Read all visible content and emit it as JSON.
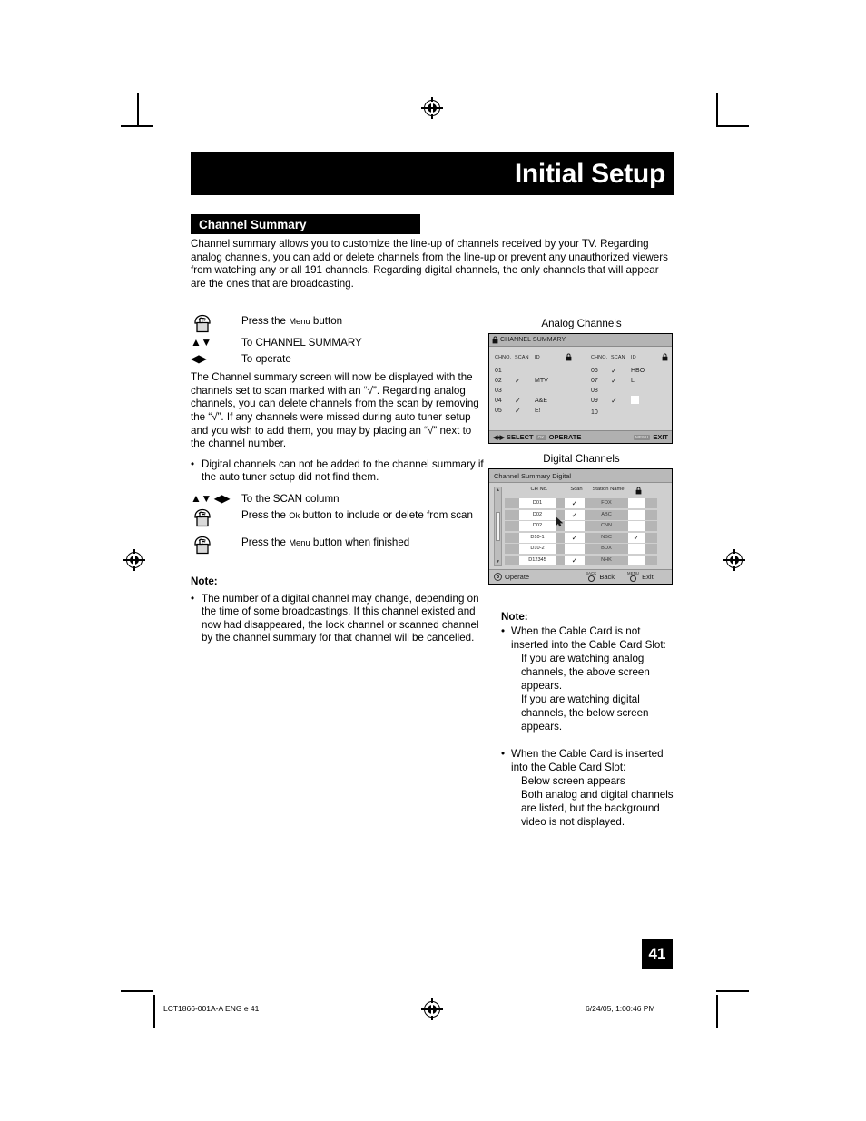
{
  "page": {
    "chapter_title": "Initial Setup",
    "section_title": "Channel Summary",
    "intro": "Channel summary allows you to customize the line-up of channels received by your TV. Regarding analog channels, you can add or delete channels from the line-up or prevent any unauthorized viewers from watching any or all 191 channels.  Regarding digital channels, the only channels that will appear are the ones that are broadcasting.",
    "page_number": "41"
  },
  "steps": [
    {
      "icon": "hand-press-icon",
      "text_pre": "Press the ",
      "smallcaps": "Menu",
      "text_post": " button"
    },
    {
      "icon": "up-down-arrows-icon",
      "glyph": "▲▼",
      "text": "To CHANNEL SUMMARY"
    },
    {
      "icon": "left-right-arrows-icon",
      "glyph": "◀▶",
      "text": "To operate"
    }
  ],
  "body": {
    "paragraph": "The Channel summary screen will now be displayed with the channels set to scan marked with an “√”. Regarding analog channels, you can delete channels from the scan by removing the “√”. If any channels were missed during auto tuner setup and you wish to add them, you may by placing an “√” next to the channel number.",
    "bullet": "Digital channels can not be added to the channel summary if the auto tuner setup did not find them."
  },
  "steps2": [
    {
      "icon": "updown-leftright-arrows-icon",
      "glyph": "▲▼ ◀▶",
      "text": "To the SCAN column"
    },
    {
      "icon": "hand-press-icon",
      "text_pre": "Press the ",
      "smallcaps": "Ok",
      "text_post": " button to include or delete from scan"
    },
    {
      "icon": "hand-press-icon",
      "text_pre": "Press the ",
      "smallcaps": "Menu",
      "text_post": " button when finished"
    }
  ],
  "left_note": {
    "heading": "Note:",
    "bullet": "The number of a digital channel may change, depending on the time of some broadcastings.  If this channel existed and now had disappeared, the lock channel or scanned channel by the channel summary for that channel will be cancelled."
  },
  "analog_screen": {
    "caption": "Analog Channels",
    "osd_title": "CHANNEL SUMMARY",
    "columns": [
      "CHNO.",
      "SCAN",
      "ID",
      "lock-icon"
    ],
    "left_rows": [
      {
        "no": "01",
        "scan": "",
        "id": ""
      },
      {
        "no": "02",
        "scan": "✓",
        "id": "MTV"
      },
      {
        "no": "03",
        "scan": "",
        "id": ""
      },
      {
        "no": "04",
        "scan": "✓",
        "id": "A&E"
      },
      {
        "no": "05",
        "scan": "✓",
        "id": "E!"
      }
    ],
    "right_rows": [
      {
        "no": "06",
        "scan": "✓",
        "id": "HBO",
        "lock": ""
      },
      {
        "no": "07",
        "scan": "✓",
        "id": "L",
        "lock": ""
      },
      {
        "no": "08",
        "scan": "",
        "id": "",
        "lock": ""
      },
      {
        "no": "09",
        "scan": "✓",
        "id": "",
        "lock": "white-box"
      },
      {
        "no": "10",
        "scan": "",
        "id": "",
        "lock": ""
      }
    ],
    "footer": {
      "select_label": "SELECT",
      "operate_key": "OK",
      "operate_label": "OPERATE",
      "exit_key": "MENU",
      "exit_label": "EXIT"
    }
  },
  "digital_screen": {
    "caption": "Digital Channels",
    "osd_title": "Channel Summary Digital",
    "columns": [
      "CH No.",
      "Scan",
      "Station Name",
      "lock-icon"
    ],
    "rows": [
      {
        "ch": "D01",
        "scan": "✓",
        "station": "FOX",
        "lock": ""
      },
      {
        "ch": "D02",
        "scan": "✓",
        "station": "ABC",
        "lock": ""
      },
      {
        "ch": "D02",
        "scan": "",
        "station": "CNN",
        "lock": ""
      },
      {
        "ch": "D10-1",
        "scan": "✓",
        "station": "NBC",
        "lock": "✓"
      },
      {
        "ch": "D10-2",
        "scan": "",
        "station": "BOX",
        "lock": ""
      },
      {
        "ch": "D12345",
        "scan": "✓",
        "station": "NHK",
        "lock": ""
      }
    ],
    "footer": {
      "operate_label": "Operate",
      "back_key": "BACK",
      "back_label": "Back",
      "exit_key": "MENU",
      "exit_label": "Exit"
    }
  },
  "right_notes": {
    "heading": "Note:",
    "items": [
      {
        "bullet": "When the Cable Card is not inserted into the Cable Card Slot:",
        "subs": [
          "If you are watching analog channels, the above screen appears.",
          "If you are watching digital channels, the below screen appears."
        ]
      },
      {
        "bullet": "When the Cable Card is inserted into the Cable Card Slot:",
        "subs": [
          "Below screen appears",
          "Both analog and digital channels are listed, but the background video is not displayed."
        ]
      }
    ]
  },
  "footer": {
    "left": "LCT1866-001A-A ENG e   41",
    "right": "6/24/05, 1:00:46 PM"
  }
}
